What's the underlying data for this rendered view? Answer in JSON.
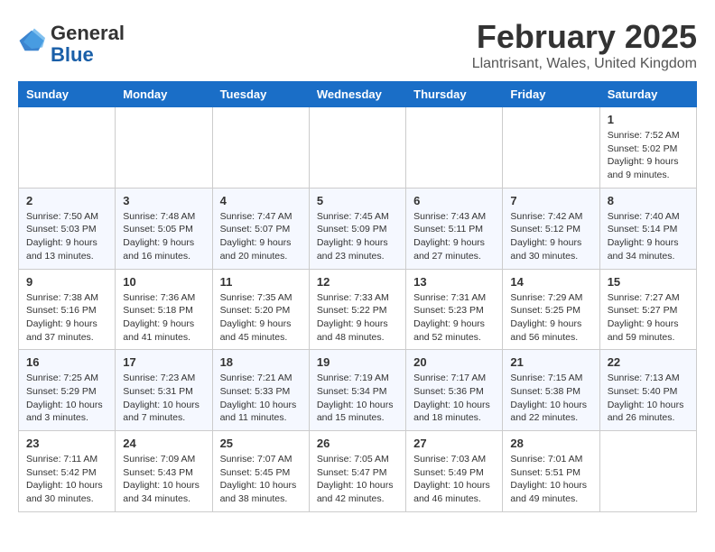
{
  "header": {
    "logo_general": "General",
    "logo_blue": "Blue",
    "title": "February 2025",
    "location": "Llantrisant, Wales, United Kingdom"
  },
  "weekdays": [
    "Sunday",
    "Monday",
    "Tuesday",
    "Wednesday",
    "Thursday",
    "Friday",
    "Saturday"
  ],
  "weeks": [
    [
      {
        "day": "",
        "info": ""
      },
      {
        "day": "",
        "info": ""
      },
      {
        "day": "",
        "info": ""
      },
      {
        "day": "",
        "info": ""
      },
      {
        "day": "",
        "info": ""
      },
      {
        "day": "",
        "info": ""
      },
      {
        "day": "1",
        "info": "Sunrise: 7:52 AM\nSunset: 5:02 PM\nDaylight: 9 hours and 9 minutes."
      }
    ],
    [
      {
        "day": "2",
        "info": "Sunrise: 7:50 AM\nSunset: 5:03 PM\nDaylight: 9 hours and 13 minutes."
      },
      {
        "day": "3",
        "info": "Sunrise: 7:48 AM\nSunset: 5:05 PM\nDaylight: 9 hours and 16 minutes."
      },
      {
        "day": "4",
        "info": "Sunrise: 7:47 AM\nSunset: 5:07 PM\nDaylight: 9 hours and 20 minutes."
      },
      {
        "day": "5",
        "info": "Sunrise: 7:45 AM\nSunset: 5:09 PM\nDaylight: 9 hours and 23 minutes."
      },
      {
        "day": "6",
        "info": "Sunrise: 7:43 AM\nSunset: 5:11 PM\nDaylight: 9 hours and 27 minutes."
      },
      {
        "day": "7",
        "info": "Sunrise: 7:42 AM\nSunset: 5:12 PM\nDaylight: 9 hours and 30 minutes."
      },
      {
        "day": "8",
        "info": "Sunrise: 7:40 AM\nSunset: 5:14 PM\nDaylight: 9 hours and 34 minutes."
      }
    ],
    [
      {
        "day": "9",
        "info": "Sunrise: 7:38 AM\nSunset: 5:16 PM\nDaylight: 9 hours and 37 minutes."
      },
      {
        "day": "10",
        "info": "Sunrise: 7:36 AM\nSunset: 5:18 PM\nDaylight: 9 hours and 41 minutes."
      },
      {
        "day": "11",
        "info": "Sunrise: 7:35 AM\nSunset: 5:20 PM\nDaylight: 9 hours and 45 minutes."
      },
      {
        "day": "12",
        "info": "Sunrise: 7:33 AM\nSunset: 5:22 PM\nDaylight: 9 hours and 48 minutes."
      },
      {
        "day": "13",
        "info": "Sunrise: 7:31 AM\nSunset: 5:23 PM\nDaylight: 9 hours and 52 minutes."
      },
      {
        "day": "14",
        "info": "Sunrise: 7:29 AM\nSunset: 5:25 PM\nDaylight: 9 hours and 56 minutes."
      },
      {
        "day": "15",
        "info": "Sunrise: 7:27 AM\nSunset: 5:27 PM\nDaylight: 9 hours and 59 minutes."
      }
    ],
    [
      {
        "day": "16",
        "info": "Sunrise: 7:25 AM\nSunset: 5:29 PM\nDaylight: 10 hours and 3 minutes."
      },
      {
        "day": "17",
        "info": "Sunrise: 7:23 AM\nSunset: 5:31 PM\nDaylight: 10 hours and 7 minutes."
      },
      {
        "day": "18",
        "info": "Sunrise: 7:21 AM\nSunset: 5:33 PM\nDaylight: 10 hours and 11 minutes."
      },
      {
        "day": "19",
        "info": "Sunrise: 7:19 AM\nSunset: 5:34 PM\nDaylight: 10 hours and 15 minutes."
      },
      {
        "day": "20",
        "info": "Sunrise: 7:17 AM\nSunset: 5:36 PM\nDaylight: 10 hours and 18 minutes."
      },
      {
        "day": "21",
        "info": "Sunrise: 7:15 AM\nSunset: 5:38 PM\nDaylight: 10 hours and 22 minutes."
      },
      {
        "day": "22",
        "info": "Sunrise: 7:13 AM\nSunset: 5:40 PM\nDaylight: 10 hours and 26 minutes."
      }
    ],
    [
      {
        "day": "23",
        "info": "Sunrise: 7:11 AM\nSunset: 5:42 PM\nDaylight: 10 hours and 30 minutes."
      },
      {
        "day": "24",
        "info": "Sunrise: 7:09 AM\nSunset: 5:43 PM\nDaylight: 10 hours and 34 minutes."
      },
      {
        "day": "25",
        "info": "Sunrise: 7:07 AM\nSunset: 5:45 PM\nDaylight: 10 hours and 38 minutes."
      },
      {
        "day": "26",
        "info": "Sunrise: 7:05 AM\nSunset: 5:47 PM\nDaylight: 10 hours and 42 minutes."
      },
      {
        "day": "27",
        "info": "Sunrise: 7:03 AM\nSunset: 5:49 PM\nDaylight: 10 hours and 46 minutes."
      },
      {
        "day": "28",
        "info": "Sunrise: 7:01 AM\nSunset: 5:51 PM\nDaylight: 10 hours and 49 minutes."
      },
      {
        "day": "",
        "info": ""
      }
    ]
  ]
}
